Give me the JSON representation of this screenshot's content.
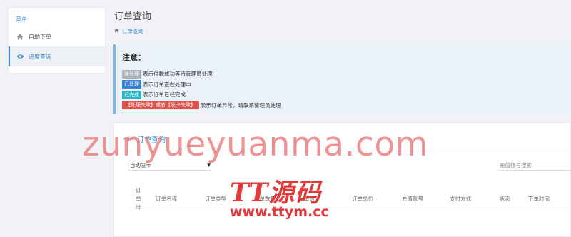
{
  "sidebar": {
    "header": "菜单",
    "items": [
      {
        "label": "自助下单",
        "icon": "home-icon"
      },
      {
        "label": "进度查询",
        "icon": "eye-icon",
        "active": true
      }
    ]
  },
  "page": {
    "title": "订单查询",
    "breadcrumb": "订单查询"
  },
  "notice": {
    "title": "注意：",
    "rows": [
      {
        "tag": "待处理",
        "text": "表示付款成功等待管理员处理"
      },
      {
        "tag": "已处理",
        "text": "表示订单正在处理中"
      },
      {
        "tag": "已完成",
        "text": "表示订单已经完成"
      },
      {
        "tag": "【处理失败】或者【发卡失败】",
        "text": "表示订单异常，请联系管理员处理"
      }
    ]
  },
  "panel": {
    "title": "订单查询",
    "select_value": "自动发卡",
    "search_placeholder": "充值账号搜索",
    "columns": [
      "订单id",
      "订单名称",
      "订单类型",
      "下单数量",
      "单价",
      "订单总价",
      "充值账号",
      "支付方式",
      "状态",
      "下单时间"
    ]
  },
  "watermark": {
    "text": "zunyueyuanma.com",
    "logo": "TT源码",
    "url": "www.ttym.cc"
  },
  "colors": {
    "accent": "#3a8fd6",
    "tag_grey": "#a8b0b8",
    "tag_blue": "#3d7fd1",
    "tag_cyan": "#2cb3c7",
    "tag_red": "#d9534f",
    "watermark": "#e23a3a"
  }
}
